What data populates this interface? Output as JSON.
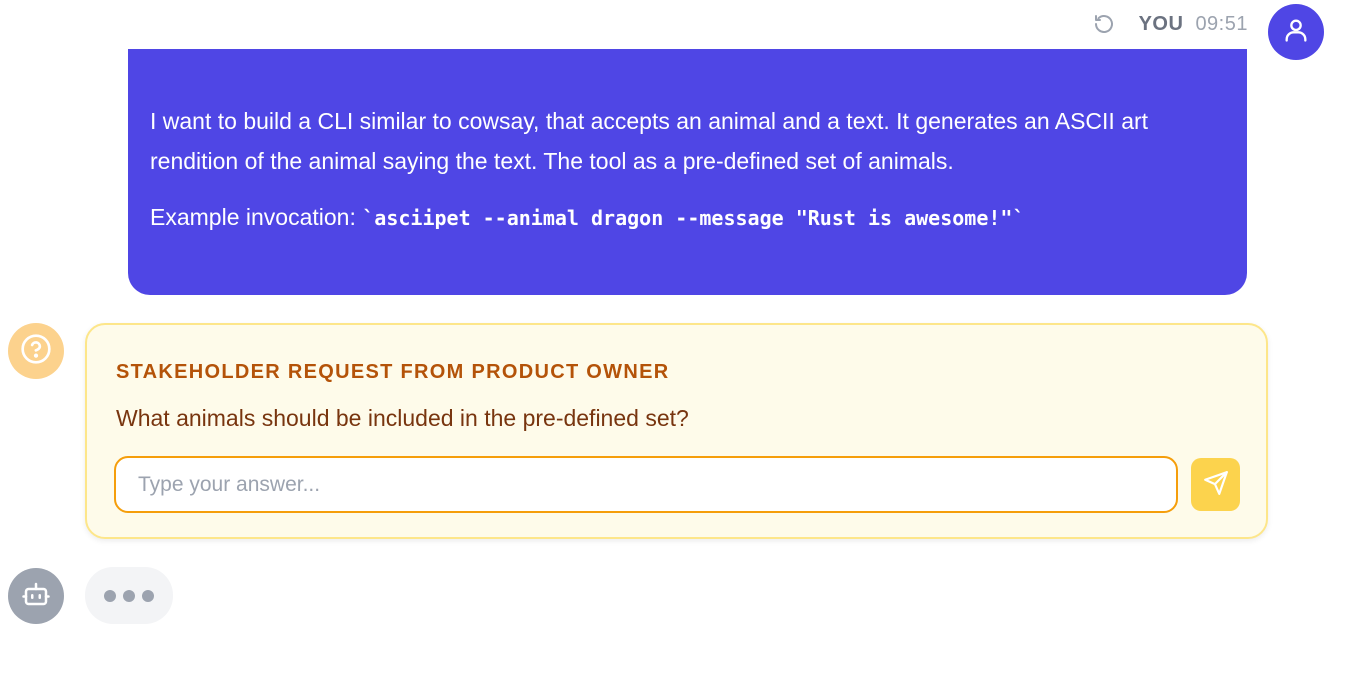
{
  "user_message": {
    "author": "YOU",
    "time": "09:51",
    "paragraph_1": "I want to build a CLI similar to cowsay, that accepts an animal and a text. It generates an ASCII art rendition of the animal saying the text. The tool as a pre-defined set of animals.",
    "example_prefix": "Example invocation: ",
    "example_code": "`asciipet --animal dragon --message \"Rust is awesome!\"`"
  },
  "stakeholder_request": {
    "title": "STAKEHOLDER REQUEST FROM PRODUCT OWNER",
    "question": "What animals should be included in the pre-defined set?",
    "input_value": "",
    "input_placeholder": "Type your answer..."
  },
  "colors": {
    "user_bubble": "#4f46e5",
    "card_background": "#fefbea",
    "card_border": "#fde68a",
    "title_accent": "#b45309",
    "send_button": "#fcd34d"
  },
  "icons": {
    "retry": "refresh-icon",
    "user_avatar": "user-icon",
    "question_avatar": "question-circle-icon",
    "send": "send-icon",
    "bot_avatar": "robot-icon"
  }
}
